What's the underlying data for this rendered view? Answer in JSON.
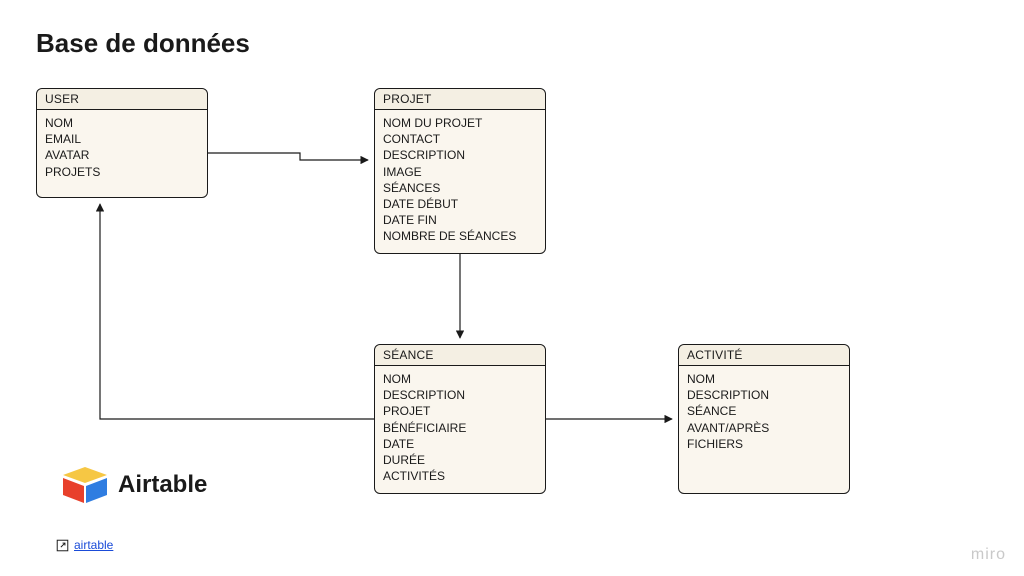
{
  "page_title": "Base de données",
  "entities": {
    "user": {
      "title": "USER",
      "fields": [
        "NOM",
        "EMAIL",
        "AVATAR",
        "PROJETS"
      ]
    },
    "projet": {
      "title": "PROJET",
      "fields": [
        "NOM DU PROJET",
        "CONTACT",
        "DESCRIPTION",
        "IMAGE",
        "SÉANCES",
        "DATE DÉBUT",
        "DATE FIN",
        "NOMBRE DE SÉANCES"
      ]
    },
    "seance": {
      "title": "SÉANCE",
      "fields": [
        "NOM",
        "DESCRIPTION",
        "PROJET",
        "BÉNÉFICIAIRE",
        "DATE",
        "DURÉE",
        "ACTIVITÉS"
      ]
    },
    "activite": {
      "title": "ACTIVITÉ",
      "fields": [
        "NOM",
        "DESCRIPTION",
        "SÉANCE",
        "AVANT/APRÈS",
        "FICHIERS"
      ]
    }
  },
  "airtable_label": "Airtable",
  "link_text": "airtable",
  "watermark": "miro"
}
